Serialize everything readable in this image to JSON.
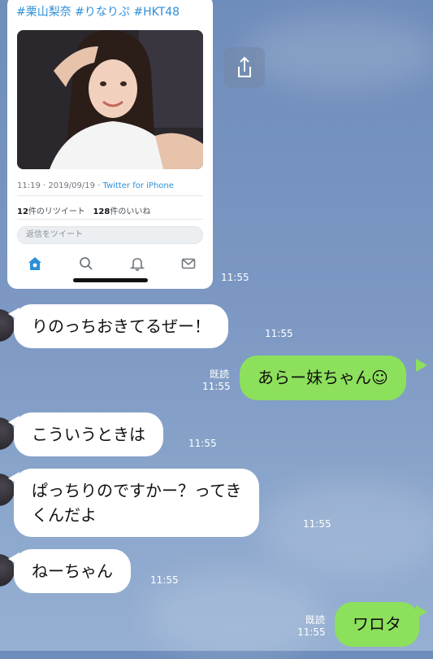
{
  "tweet": {
    "hashtags": "#栗山梨奈 #りなりぷ #HKT48",
    "time_date": "11:19 · 2019/09/19 · ",
    "source": "Twitter for iPhone",
    "retweets_count": "12",
    "retweets_label": "件のリツイート",
    "likes_count": "128",
    "likes_label": "件のいいね",
    "reply_placeholder": "返信をツイート",
    "nav_icons": [
      "home-icon",
      "search-icon",
      "notifications-icon",
      "messages-icon"
    ]
  },
  "shared_time": "11:55",
  "messages": [
    {
      "side": "in",
      "text": "りのっちおきてるぜー！",
      "time": "11:55"
    },
    {
      "side": "out",
      "text": "あらー妹ちゃん☺",
      "read": "既読",
      "time": "11:55"
    },
    {
      "side": "in",
      "text": "こういうときは",
      "time": "11:55"
    },
    {
      "side": "in",
      "line1": "ぱっちりのですかー？ってき",
      "line2": "くんだよ",
      "time": "11:55"
    },
    {
      "side": "in",
      "text": "ねーちゃん",
      "time": "11:55"
    },
    {
      "side": "out",
      "text": "ワロタ",
      "read": "既読",
      "time": "11:55"
    }
  ],
  "colors": {
    "out_bubble": "#8de05c",
    "link": "#2f8fd8",
    "background": "#7b97c2"
  }
}
